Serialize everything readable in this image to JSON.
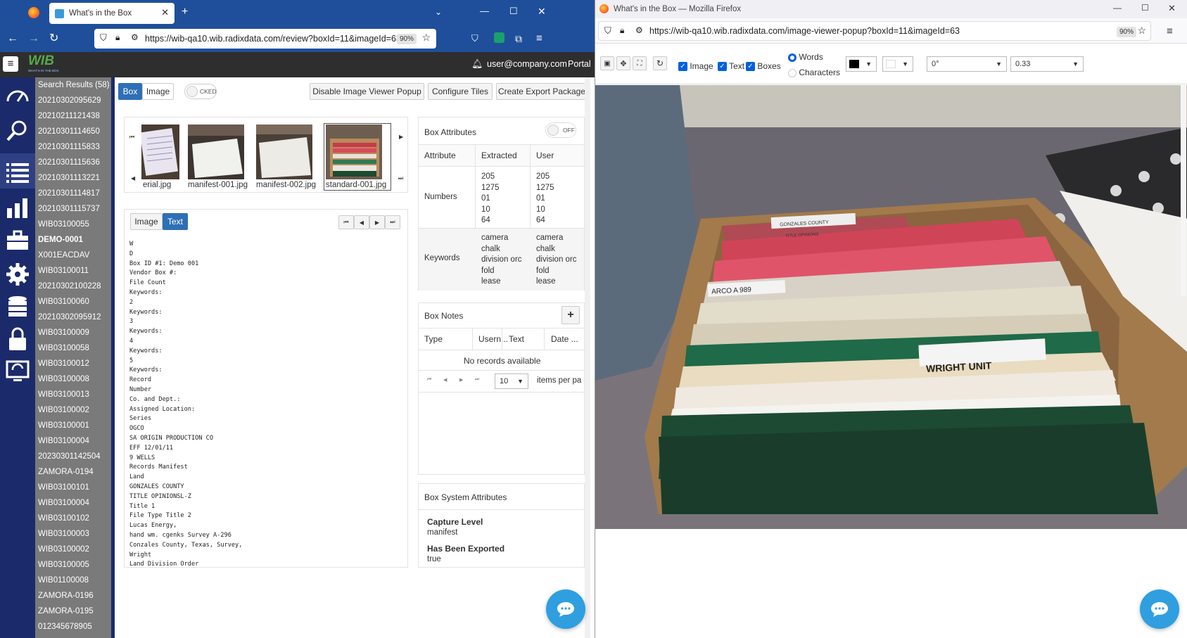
{
  "left_window": {
    "tab_title": "What's in the Box",
    "url": "https://wib-qa10.wib.radixdata.com/review?boxId=11&imageId=63",
    "zoom": "90%"
  },
  "app": {
    "logo_text": "WIB",
    "logo_sub": "WHAT'S IN THE BOX",
    "user": "user@company.com",
    "portal_label": "Portal"
  },
  "search": {
    "header": "Search Results (58)",
    "items": [
      "20210302095629",
      "20210211121438",
      "20210301114650",
      "20210301115833",
      "20210301115636",
      "20210301113221",
      "20210301114817",
      "20210301115737",
      "WIB03100055",
      "DEMO-0001",
      "X001EACDAV",
      "WIB03100011",
      "20210302100228",
      "WIB03100060",
      "20210302095912",
      "WIB03100009",
      "WIB03100058",
      "WIB03100012",
      "WIB03100008",
      "WIB03100013",
      "WIB03100002",
      "WIB03100001",
      "WIB03100004",
      "20230301142504",
      "ZAMORA-0194",
      "WIB03100101",
      "WIB03100004",
      "WIB03100102",
      "WIB03100003",
      "WIB03100002",
      "WIB03100005",
      "WIB01100008",
      "ZAMORA-0196",
      "ZAMORA-0195",
      "012345678905"
    ],
    "selected": "DEMO-0001"
  },
  "toolbar": {
    "box_tab": "Box",
    "image_tab": "Image",
    "toggle_label": "CKED",
    "disable_popup": "Disable Image Viewer Popup",
    "configure_tiles": "Configure Tiles",
    "create_export": "Create Export Package"
  },
  "thumbnails": [
    {
      "caption": "erial.jpg"
    },
    {
      "caption": "manifest-001.jpg"
    },
    {
      "caption": "manifest-002.jpg"
    },
    {
      "caption": "standard-001.jpg"
    }
  ],
  "viewer_tabs": {
    "image": "Image",
    "text": "Text"
  },
  "ocr_lines": [
    "W",
    "D",
    "Box ID #1: Demo 001",
    "Vendor Box #:",
    "File Count",
    "Keywords:",
    "2",
    "Keywords:",
    "3",
    "Keywords:",
    "4",
    "Keywords:",
    "5",
    "Keywords:",
    "Record",
    "Number",
    "Co. and Dept.:",
    "Assigned Location:",
    "Series",
    "OGCO",
    "SA ORIGIN PRODUCTION CO",
    "EFF 12/01/11",
    "9 WELLS",
    "Records Manifest",
    "Land",
    "GONZALES COUNTY",
    "TITLE OPINIONSL-Z",
    "Title 1",
    "File Type Title 2",
    "Lucas Energy,",
    "hand wm. cgenks Survey A-296",
    "Conzales County, Texas, Survey,",
    "Wright",
    "Land Division Order"
  ],
  "box_attributes": {
    "title": "Box Attributes",
    "toggle": "OFF",
    "col_attribute": "Attribute",
    "col_extracted": "Extracted",
    "col_user": "User",
    "rows": [
      {
        "name": "Numbers",
        "extracted": [
          "205",
          "1275",
          "01",
          "10",
          "64"
        ],
        "user": [
          "205",
          "1275",
          "01",
          "10",
          "64"
        ]
      },
      {
        "name": "Keywords",
        "extracted": [
          "camera",
          "chalk",
          "division orc",
          "fold",
          "lease"
        ],
        "user": [
          "camera",
          "chalk",
          "division orc",
          "fold",
          "lease"
        ]
      }
    ]
  },
  "box_notes": {
    "title": "Box Notes",
    "col_type": "Type",
    "col_user": "Usern...",
    "col_text": "Text",
    "col_date": "Date ...",
    "empty": "No records available",
    "page_size": "10",
    "page_size_label": "items per pa"
  },
  "system_attributes": {
    "title": "Box System Attributes",
    "capture_label": "Capture Level",
    "capture_value": "manifest",
    "exported_label": "Has Been Exported",
    "exported_value": "true"
  },
  "right_window": {
    "title": "What's in the Box — Mozilla Firefox",
    "url": "https://wib-qa10.wib.radixdata.com/image-viewer-popup?boxId=11&imageId=63",
    "zoom": "90%",
    "chk_image": "Image",
    "chk_text": "Text",
    "chk_boxes": "Boxes",
    "radio_words": "Words",
    "radio_chars": "Characters",
    "rotation": "0°",
    "opacity": "0.33"
  },
  "photo_labels": {
    "wright": "WRIGHT UNIT",
    "arco": "ARCO A 989",
    "gonzales": "GONZALES COUNTY",
    "title_opinions": "TITLE OPINIONS"
  },
  "colors": {
    "brand_blue": "#1b2a6b",
    "accent": "#2f6fb5",
    "chat": "#2f9fe0"
  }
}
